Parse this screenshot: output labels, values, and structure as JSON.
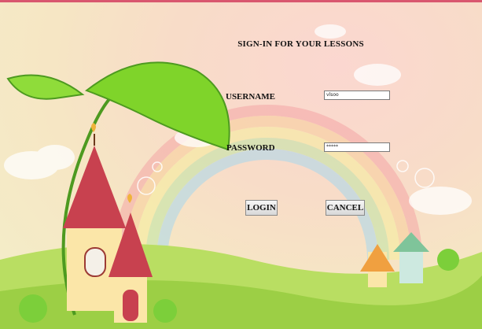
{
  "form": {
    "title": "SIGN-IN FOR YOUR LESSONS",
    "username_label": "USERNAME",
    "password_label": "PASSWORD",
    "username_value": "vlsoo",
    "password_value": "*****",
    "login_label": "LOGIN",
    "cancel_label": "CANCEL"
  },
  "colors": {
    "top_bar": "#d9576f",
    "leaf": "#7fd42a",
    "roof": "#c8414f",
    "hill": "#a7d64c"
  }
}
